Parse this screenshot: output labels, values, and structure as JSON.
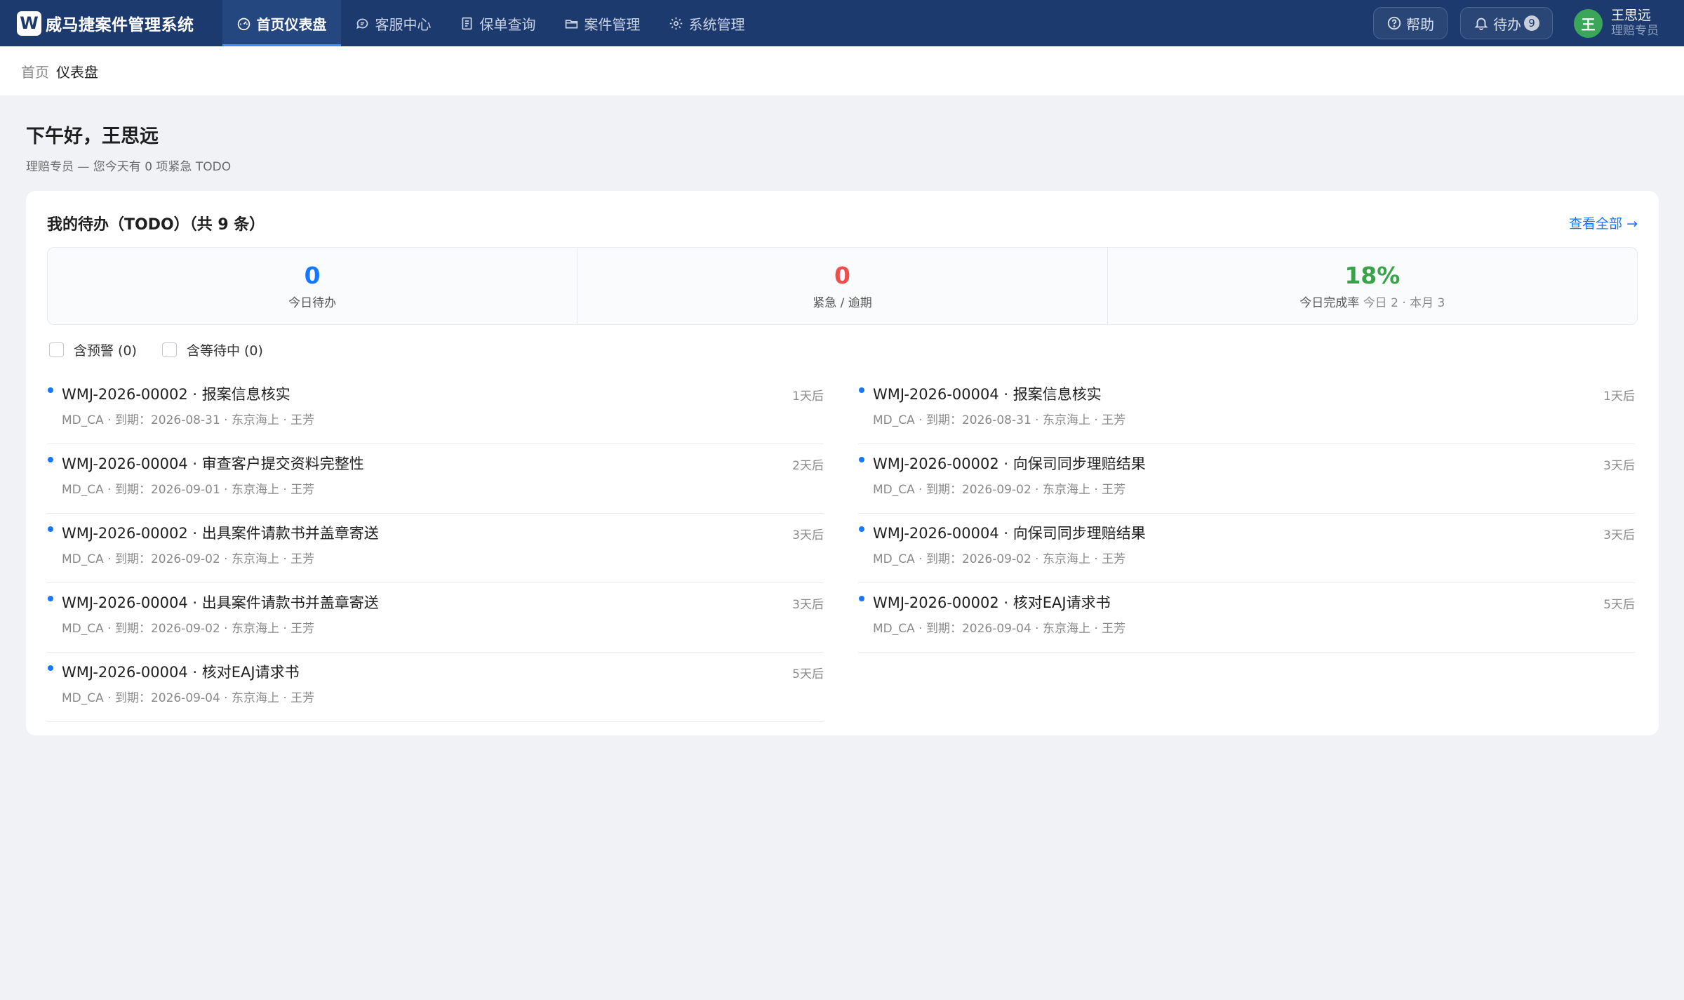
{
  "app": {
    "logo_letter": "W",
    "name": "威马捷案件管理系统"
  },
  "nav": [
    {
      "label": "首页仪表盘",
      "icon": "dashboard-icon",
      "active": true
    },
    {
      "label": "客服中心",
      "icon": "chat-icon",
      "active": false
    },
    {
      "label": "保单查询",
      "icon": "document-icon",
      "active": false
    },
    {
      "label": "案件管理",
      "icon": "folder-icon",
      "active": false
    },
    {
      "label": "系统管理",
      "icon": "gear-icon",
      "active": false
    }
  ],
  "header": {
    "help_label": "帮助",
    "todo_label": "待办",
    "todo_count": "9",
    "user": {
      "avatar_letter": "王",
      "name": "王思远",
      "role": "理赔专员"
    }
  },
  "breadcrumb": {
    "home": "首页",
    "current": "仪表盘"
  },
  "greeting": {
    "title": "下午好，王思远",
    "subtitle": "理赔专员 — 您今天有 0 项紧急 TODO"
  },
  "todo_card": {
    "title": "我的待办（TODO）（共 9 条）",
    "view_all": "查看全部 →",
    "stats": [
      {
        "value": "0",
        "label": "今日待办",
        "extra": "",
        "color": "#1677ff"
      },
      {
        "value": "0",
        "label": "紧急 / 逾期",
        "extra": "",
        "color": "#f04d4d"
      },
      {
        "value": "18%",
        "label": "今日完成率",
        "extra": "今日 2 · 本月 3",
        "color": "#3aa34a"
      }
    ],
    "filters": [
      {
        "label": "含预警 (0)"
      },
      {
        "label": "含等待中 (0)"
      }
    ],
    "left_items": [
      {
        "title": "WMJ-2026-00002 · 报案信息核实",
        "meta": "MD_CA · 到期：2026-08-31 · 东京海上 · 王芳",
        "due": "1天后"
      },
      {
        "title": "WMJ-2026-00004 · 审查客户提交资料完整性",
        "meta": "MD_CA · 到期：2026-09-01 · 东京海上 · 王芳",
        "due": "2天后"
      },
      {
        "title": "WMJ-2026-00002 · 出具案件请款书并盖章寄送",
        "meta": "MD_CA · 到期：2026-09-02 · 东京海上 · 王芳",
        "due": "3天后"
      },
      {
        "title": "WMJ-2026-00004 · 出具案件请款书并盖章寄送",
        "meta": "MD_CA · 到期：2026-09-02 · 东京海上 · 王芳",
        "due": "3天后"
      },
      {
        "title": "WMJ-2026-00004 · 核对EAJ请求书",
        "meta": "MD_CA · 到期：2026-09-04 · 东京海上 · 王芳",
        "due": "5天后"
      }
    ],
    "right_items": [
      {
        "title": "WMJ-2026-00004 · 报案信息核实",
        "meta": "MD_CA · 到期：2026-08-31 · 东京海上 · 王芳",
        "due": "1天后"
      },
      {
        "title": "WMJ-2026-00002 · 向保司同步理赔结果",
        "meta": "MD_CA · 到期：2026-09-02 · 东京海上 · 王芳",
        "due": "3天后"
      },
      {
        "title": "WMJ-2026-00004 · 向保司同步理赔结果",
        "meta": "MD_CA · 到期：2026-09-02 · 东京海上 · 王芳",
        "due": "3天后"
      },
      {
        "title": "WMJ-2026-00002 · 核对EAJ请求书",
        "meta": "MD_CA · 到期：2026-09-04 · 东京海上 · 王芳",
        "due": "5天后"
      }
    ]
  },
  "colors": {
    "nav_bg": "#1d3a6e",
    "accent": "#1677ff",
    "danger": "#f04d4d",
    "success": "#3aa34a",
    "page_bg": "#f0f2f5"
  }
}
